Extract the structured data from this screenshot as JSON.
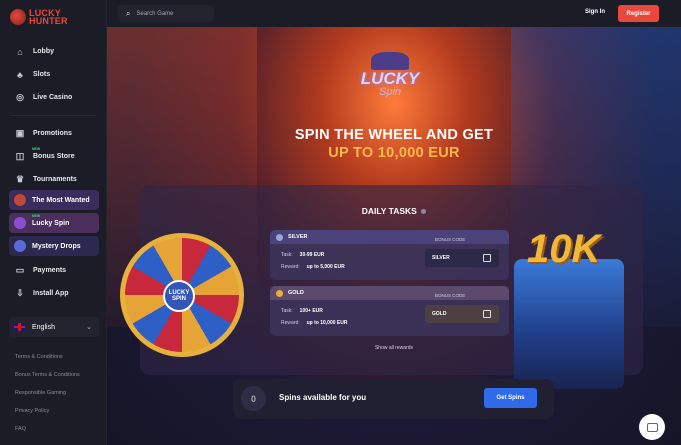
{
  "brand": {
    "line1": "LUCKY",
    "line2": "HUNTER"
  },
  "header": {
    "search_placeholder": "Search Game",
    "signin": "Sign In",
    "register": "Register"
  },
  "sidebar": {
    "items": [
      {
        "label": "Lobby",
        "icon": "home-icon"
      },
      {
        "label": "Slots",
        "icon": "slots-icon"
      },
      {
        "label": "Live Casino",
        "icon": "roulette-icon"
      }
    ],
    "items2": [
      {
        "label": "Promotions",
        "icon": "gift-icon",
        "badge": ""
      },
      {
        "label": "Bonus Store",
        "icon": "bag-icon",
        "badge": "NEW"
      },
      {
        "label": "Tournaments",
        "icon": "trophy-icon",
        "badge": ""
      }
    ],
    "promos": [
      {
        "label": "The Most Wanted",
        "badge": "",
        "bg": "#3a2c5c"
      },
      {
        "label": "Lucky Spin",
        "badge": "NEW",
        "bg": "#4a2e5c"
      },
      {
        "label": "Mystery Drops",
        "badge": "",
        "bg": "#2c2950"
      }
    ],
    "items3": [
      {
        "label": "Payments",
        "icon": "card-icon"
      },
      {
        "label": "Install App",
        "icon": "download-icon"
      }
    ],
    "language": "English",
    "footer_links": [
      "Terms & Conditions",
      "Bonus Terms & Conditions",
      "Responsible Gaming",
      "Privacy Policy",
      "FAQ"
    ]
  },
  "hero": {
    "logo_line1": "LUCKY",
    "logo_line2": "Spin",
    "title_line1": "SPIN THE WHEEL AND GET",
    "title_line2": "UP TO 10,000 EUR"
  },
  "tasks": {
    "title": "DAILY TASKS",
    "bonus_code_label": "BONUS CODE",
    "task_label": "Task:",
    "reward_label": "Reward:",
    "list": [
      {
        "tier": "SILVER",
        "task": "30-99 EUR",
        "reward": "up to 5,000 EUR",
        "code": "SILVER",
        "color": "#9aa6d8",
        "head_bg": "#4a4278"
      },
      {
        "tier": "GOLD",
        "task": "100+ EUR",
        "reward": "up to 10,000 EUR",
        "code": "GOLD",
        "color": "#e8b13b",
        "head_bg": "#5b4a6b"
      }
    ],
    "show_all": "Show all rewards"
  },
  "spins": {
    "count": "0",
    "label": "Spins available for you",
    "button": "Get Spins"
  },
  "wheel": {
    "hub_line1": "LUCKY",
    "hub_line2": "SPIN"
  },
  "chest": {
    "text": "10K"
  }
}
